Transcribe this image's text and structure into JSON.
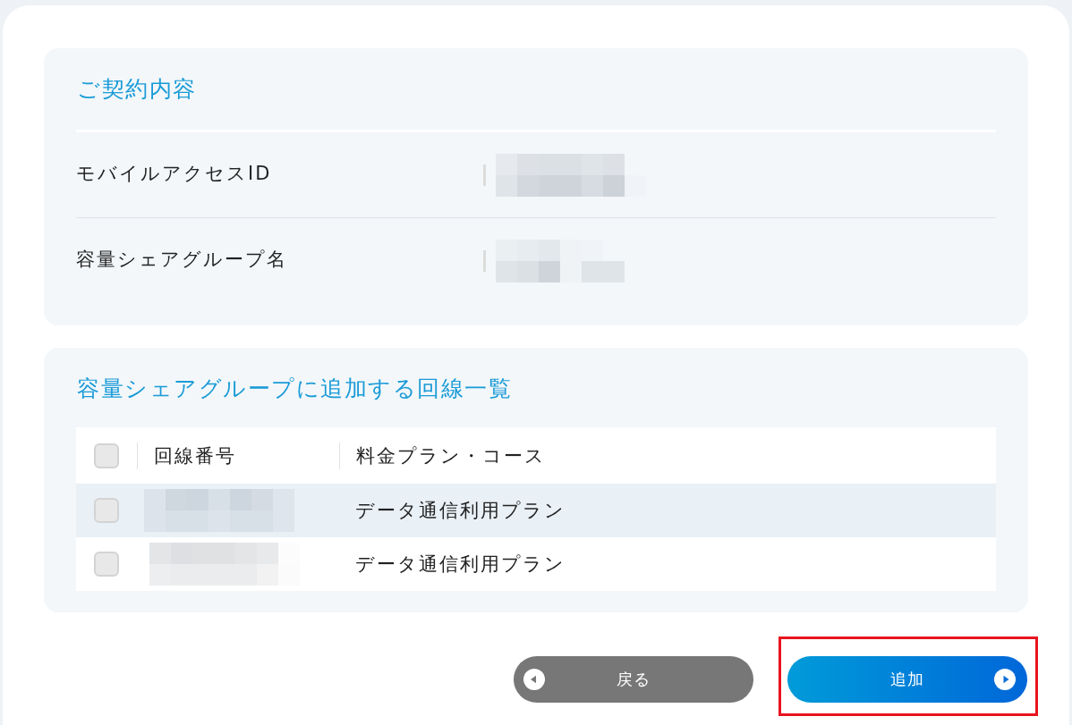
{
  "contract_panel": {
    "title": "ご契約内容",
    "rows": [
      {
        "label": "モバイルアクセスID",
        "value_redacted": true
      },
      {
        "label": "容量シェアグループ名",
        "value_redacted": true
      }
    ]
  },
  "lines_panel": {
    "title": "容量シェアグループに追加する回線一覧",
    "table": {
      "select_all_checked": false,
      "columns": [
        "回線番号",
        "料金プラン・コース"
      ],
      "rows": [
        {
          "checked": false,
          "highlighted": true,
          "line_number_redacted": true,
          "plan": "データ通信利用プラン"
        },
        {
          "checked": false,
          "highlighted": false,
          "line_number_redacted": true,
          "plan": "データ通信利用プラン"
        }
      ]
    }
  },
  "buttons": [
    {
      "kind": "back",
      "label": "戻る",
      "highlighted": false
    },
    {
      "kind": "next",
      "label": "追加",
      "highlighted": true
    }
  ]
}
